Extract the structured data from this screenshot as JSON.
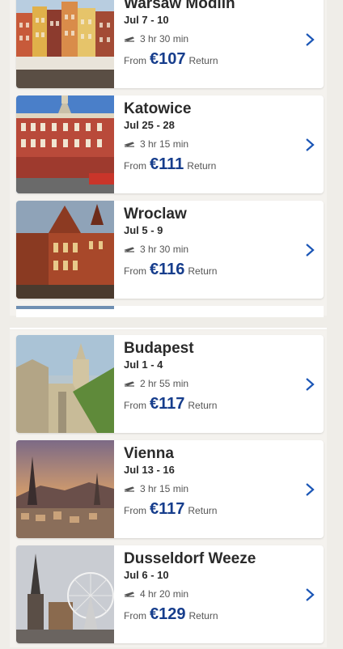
{
  "destinations_top": [
    {
      "city": "Warsaw Modlin",
      "dates": "Jul 7 - 10",
      "duration": "3 hr 30 min",
      "from": "From",
      "price": "€107",
      "return": "Return",
      "icon": "flight-icon"
    },
    {
      "city": "Katowice",
      "dates": "Jul 25 - 28",
      "duration": "3 hr 15 min",
      "from": "From",
      "price": "€111",
      "return": "Return",
      "icon": "flight-icon"
    },
    {
      "city": "Wroclaw",
      "dates": "Jul 5 - 9",
      "duration": "3 hr 30 min",
      "from": "From",
      "price": "€116",
      "return": "Return",
      "icon": "flight-icon"
    }
  ],
  "destinations_bottom": [
    {
      "city": "Budapest",
      "dates": "Jul 1 - 4",
      "duration": "2 hr 55 min",
      "from": "From",
      "price": "€117",
      "return": "Return",
      "icon": "flight-icon"
    },
    {
      "city": "Vienna",
      "dates": "Jul 13 - 16",
      "duration": "3 hr 15 min",
      "from": "From",
      "price": "€117",
      "return": "Return",
      "icon": "flight-icon"
    },
    {
      "city": "Dusseldorf Weeze",
      "dates": "Jul 6 - 10",
      "duration": "4 hr 20 min",
      "from": "From",
      "price": "€129",
      "return": "Return",
      "icon": "flight-icon"
    }
  ],
  "colors": {
    "price": "#163d8c",
    "chevron": "#1b56b6",
    "text": "#2a2a2a",
    "background": "#efede8"
  }
}
